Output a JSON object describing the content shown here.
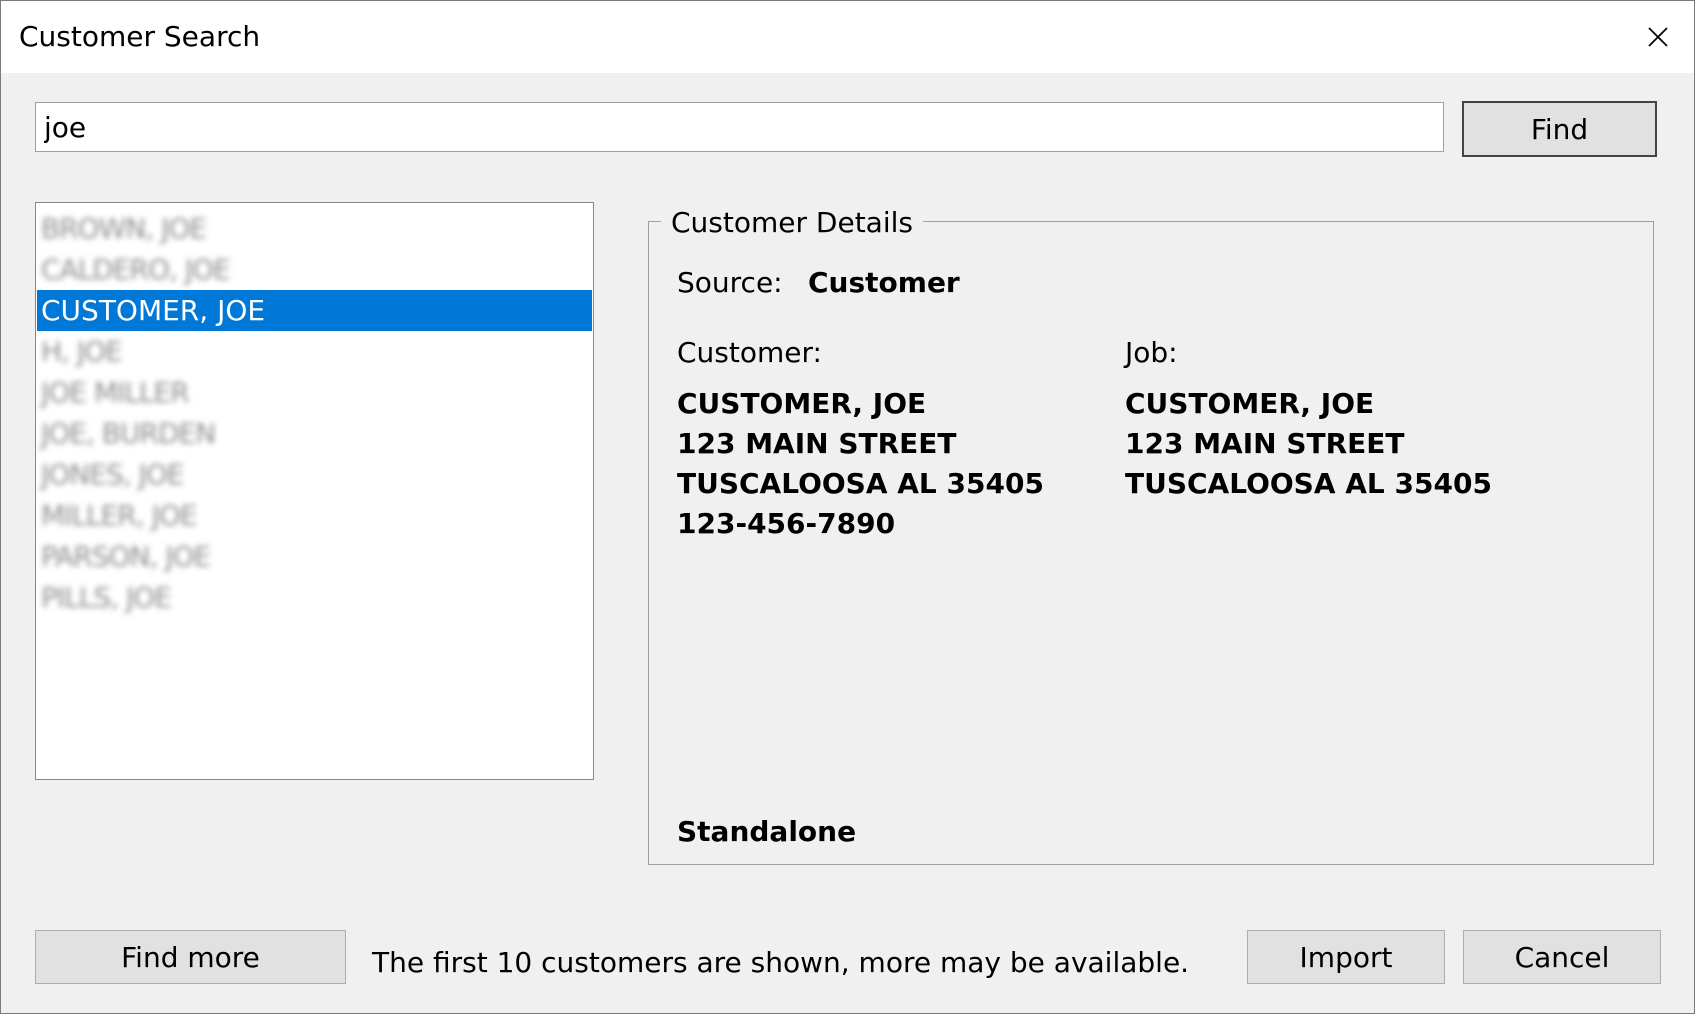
{
  "window": {
    "title": "Customer Search"
  },
  "search": {
    "value": "joe",
    "find_label": "Find"
  },
  "results": {
    "items": [
      {
        "label": "BROWN, JOE",
        "blurred": true
      },
      {
        "label": "CALDERO, JOE",
        "blurred": true
      },
      {
        "label": "CUSTOMER, JOE",
        "blurred": false,
        "selected": true
      },
      {
        "label": "H, JOE",
        "blurred": true
      },
      {
        "label": "JOE MILLER",
        "blurred": true
      },
      {
        "label": "JOE, BURDEN",
        "blurred": true
      },
      {
        "label": "JONES, JOE",
        "blurred": true
      },
      {
        "label": "MILLER, JOE",
        "blurred": true
      },
      {
        "label": "PARSON, JOE",
        "blurred": true
      },
      {
        "label": "PILLS, JOE",
        "blurred": true
      }
    ]
  },
  "details": {
    "group_label": "Customer Details",
    "source_label": "Source:",
    "source_value": "Customer",
    "customer_label": "Customer:",
    "job_label": "Job:",
    "customer_lines": [
      "CUSTOMER, JOE",
      "123 MAIN STREET",
      "TUSCALOOSA AL 35405",
      "123-456-7890"
    ],
    "job_lines": [
      "CUSTOMER, JOE",
      "123 MAIN STREET",
      "TUSCALOOSA AL 35405"
    ],
    "mode": "Standalone"
  },
  "footer": {
    "find_more_label": "Find more",
    "status_text": "The first 10 customers are shown, more may be available.",
    "import_label": "Import",
    "cancel_label": "Cancel"
  },
  "colors": {
    "selection": "#0078d7",
    "window_bg": "#f0f0f0",
    "button_bg": "#e1e1e1"
  }
}
